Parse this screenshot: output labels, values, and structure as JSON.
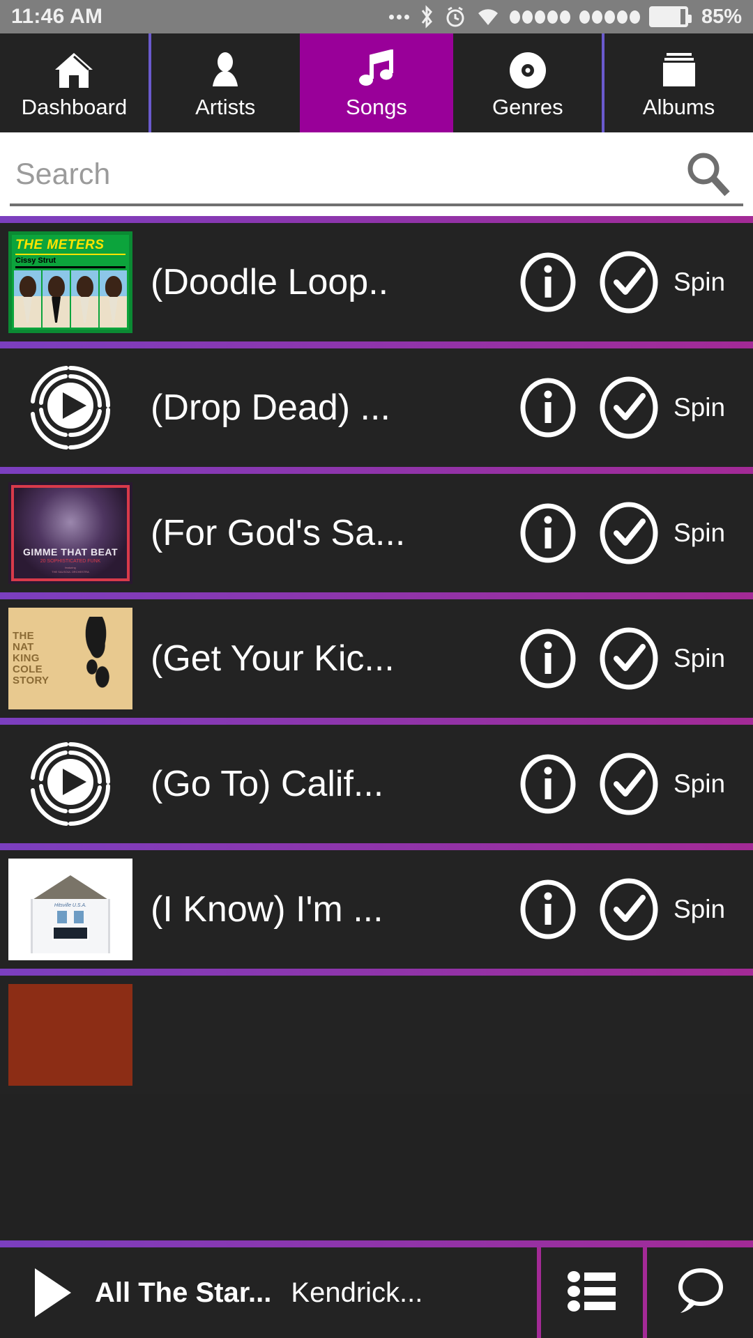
{
  "status_bar": {
    "time": "11:46 AM",
    "battery_percent": "85%",
    "battery_level": 85,
    "icons": [
      "more-dots-icon",
      "bluetooth-icon",
      "alarm-icon",
      "wifi-icon",
      "signal-dots-icon",
      "signal-dots-icon",
      "battery-icon"
    ]
  },
  "tabs": [
    {
      "label": "Dashboard",
      "icon": "home-icon",
      "active": false
    },
    {
      "label": "Artists",
      "icon": "person-icon",
      "active": false
    },
    {
      "label": "Songs",
      "icon": "music-note-icon",
      "active": true
    },
    {
      "label": "Genres",
      "icon": "vinyl-disc-icon",
      "active": false
    },
    {
      "label": "Albums",
      "icon": "albums-icon",
      "active": false
    }
  ],
  "search": {
    "placeholder": "Search",
    "value": "",
    "icon": "search-icon"
  },
  "song_list": {
    "action_info_icon": "info-icon",
    "action_check_icon": "check-circle-icon",
    "spin_label": "Spin",
    "rows": [
      {
        "title": "(Doodle Loop..",
        "art": "meters",
        "art_name": "album-art-the-meters-cissy-strut"
      },
      {
        "title": "(Drop Dead) ...",
        "art": "placeholder",
        "art_name": "album-art-placeholder-play-icon"
      },
      {
        "title": "(For God's Sa...",
        "art": "gimme",
        "art_name": "album-art-gimme-that-beat"
      },
      {
        "title": "(Get Your Kic...",
        "art": "nat",
        "art_name": "album-art-the-nat-king-cole-story"
      },
      {
        "title": "(Go To) Calif...",
        "art": "placeholder",
        "art_name": "album-art-placeholder-play-icon"
      },
      {
        "title": "(I Know) I'm ...",
        "art": "motown",
        "art_name": "album-art-hitsville-usa-motown"
      },
      {
        "title": "",
        "art": "last",
        "art_name": "album-art-partial-row"
      }
    ]
  },
  "player_bar": {
    "play_icon": "play-icon",
    "track_title": "All The Star...",
    "artist": "Kendrick...",
    "queue_icon": "list-icon",
    "chat_icon": "speech-bubble-icon"
  },
  "colors": {
    "accent_purple": "#990099",
    "separator_left": "#7b3fbf",
    "separator_right": "#a32a96",
    "tab_divider": "#6a5acd",
    "row_bg": "#232323",
    "page_bg": "#222222",
    "status_bar_bg": "#7e7e7e"
  }
}
